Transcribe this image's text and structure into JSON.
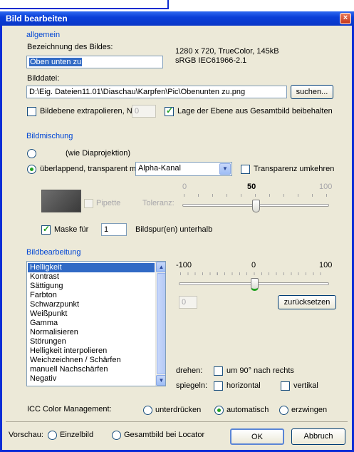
{
  "window": {
    "title": "Bild bearbeiten",
    "close_glyph": "×"
  },
  "allgemein": {
    "heading": "allgemein",
    "name_label": "Bezeichnung des Bildes:",
    "name_value": "Oben unten zu",
    "info_line1": "1280 x 720, TrueColor, 145kB",
    "info_line2": "sRGB IEC61966-2.1",
    "file_label": "Bilddatei:",
    "file_value": "D:\\Eig. Dateien11.01\\Diaschau\\Karpfen\\Pic\\Obenunten zu.png",
    "browse_label": "suchen...",
    "extrapolate_label": "Bildebene extrapolieren, Nr.:",
    "extrapolate_nr": "0",
    "keep_position_label": "Lage der Ebene aus Gesamtbild beibehalten"
  },
  "bildmischung": {
    "heading": "Bildmischung",
    "radio_normal_label": "(wie Diaprojektion)",
    "radio_overlap_label": "überlappend, transparent mit",
    "combo_value": "Alpha-Kanal",
    "invert_label": "Transparenz umkehren",
    "tol_min": "0",
    "tol_mid": "50",
    "tol_max": "100",
    "pipette_label": "Pipette",
    "tolerance_label": "Toleranz:",
    "tolerance_value_pct": 50,
    "mask_label": "Maske für",
    "mask_value": "1",
    "mask_suffix": "Bildspur(en) unterhalb"
  },
  "bildbearbeitung": {
    "heading": "Bildbearbeitung",
    "items": [
      "Helligkeit",
      "Kontrast",
      "Sättigung",
      "Farbton",
      "Schwarzpunkt",
      "Weißpunkt",
      "Gamma",
      "Normalisieren",
      "Störungen",
      "Helligkeit interpolieren",
      "Weichzeichnen / Schärfen",
      "manuell Nachschärfen",
      "Negativ"
    ],
    "selected_index": 0,
    "scale_min": "-100",
    "scale_mid": "0",
    "scale_max": "100",
    "value": "0",
    "slider_value": 0,
    "reset_label": "zurücksetzen",
    "rotate_label": "drehen:",
    "rotate_option": "um 90° nach rechts",
    "mirror_label": "spiegeln:",
    "mirror_h": "horizontal",
    "mirror_v": "vertikal"
  },
  "icc": {
    "label": "ICC Color Management:",
    "opt1": "unterdrücken",
    "opt2": "automatisch",
    "opt3": "erzwingen",
    "selected": "automatisch"
  },
  "footer": {
    "preview_label": "Vorschau:",
    "preview_opt1": "Einzelbild",
    "preview_opt2": "Gesamtbild bei Locator",
    "ok_label": "OK",
    "cancel_label": "Abbruch"
  },
  "colors": {
    "xp_blue": "#0a2dd6",
    "dialog_face": "#ece9d8",
    "section_blue": "#0046d5",
    "annotation_arrow": "#1e55e8",
    "selection": "#316ac5"
  }
}
